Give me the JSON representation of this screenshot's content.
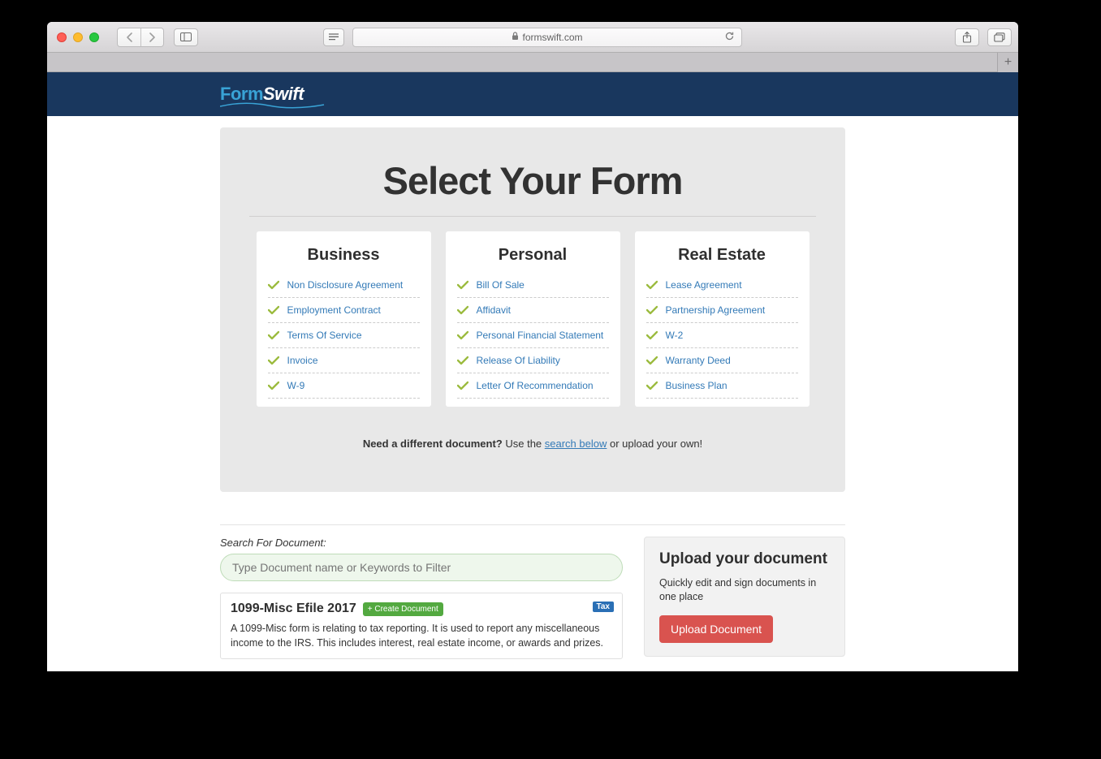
{
  "browser": {
    "url_host": "formswift.com"
  },
  "logo": {
    "part1": "Form",
    "part2": "Swift"
  },
  "hero": {
    "title": "Select Your Form",
    "columns": [
      {
        "heading": "Business",
        "items": [
          "Non Disclosure Agreement",
          "Employment Contract",
          "Terms Of Service",
          "Invoice",
          "W-9"
        ]
      },
      {
        "heading": "Personal",
        "items": [
          "Bill Of Sale",
          "Affidavit",
          "Personal Financial Statement",
          "Release Of Liability",
          "Letter Of Recommendation"
        ]
      },
      {
        "heading": "Real Estate",
        "items": [
          "Lease Agreement",
          "Partnership Agreement",
          "W-2",
          "Warranty Deed",
          "Business Plan"
        ]
      }
    ],
    "diff_prompt_bold": "Need a different document?",
    "diff_prompt_before": " Use the ",
    "diff_prompt_link": "search below",
    "diff_prompt_after": " or upload your own!"
  },
  "search": {
    "label": "Search For Document:",
    "placeholder": "Type Document name or Keywords to Filter"
  },
  "result": {
    "title": "1099-Misc Efile 2017",
    "create_label": "+ Create Document",
    "tag": "Tax",
    "desc": "A 1099-Misc form is relating to tax reporting. It is used to report any miscellaneous income to the IRS. This includes interest, real estate income, or awards and prizes."
  },
  "upload": {
    "title": "Upload your document",
    "desc": "Quickly edit and sign documents in one place",
    "btn": "Upload Document"
  }
}
